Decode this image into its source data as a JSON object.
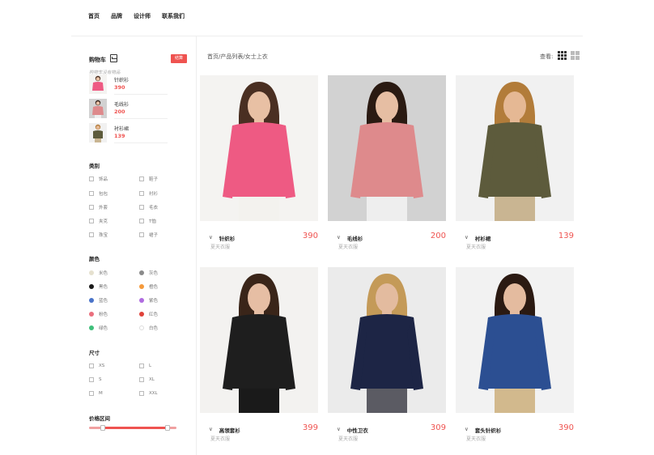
{
  "nav": [
    "首页",
    "品牌",
    "设计师",
    "联系我们"
  ],
  "cart": {
    "title": "购物车",
    "checkout_label": "结算",
    "empty_text": "购物车没有物品",
    "items": [
      {
        "name": "针织衫",
        "price": "390"
      },
      {
        "name": "毛线衫",
        "price": "200"
      },
      {
        "name": "衬衫裙",
        "price": "139"
      }
    ]
  },
  "filters": {
    "category": {
      "title": "类别",
      "options": [
        "饰品",
        "鞋子",
        "包包",
        "衬衫",
        "外套",
        "毛衣",
        "夹克",
        "T恤",
        "珠宝",
        "裙子"
      ]
    },
    "color": {
      "title": "颜色",
      "options": [
        {
          "label": "米色",
          "color": "#e6e1cf"
        },
        {
          "label": "灰色",
          "color": "#8a8a8a"
        },
        {
          "label": "黑色",
          "color": "#1a1a1a"
        },
        {
          "label": "橙色",
          "color": "#f59a3c"
        },
        {
          "label": "蓝色",
          "color": "#4a74c9"
        },
        {
          "label": "紫色",
          "color": "#b06ce0"
        },
        {
          "label": "粉色",
          "color": "#ea6f7d"
        },
        {
          "label": "红色",
          "color": "#e0423a"
        },
        {
          "label": "绿色",
          "color": "#3fbf7a"
        },
        {
          "label": "白色",
          "color": "#ffffff"
        }
      ]
    },
    "size": {
      "title": "尺寸",
      "options": [
        "XS",
        "L",
        "S",
        "XL",
        "M",
        "XXL"
      ]
    },
    "price": {
      "title": "价格区间"
    }
  },
  "main": {
    "breadcrumb": "首页/产品列表/女士上衣",
    "view_label": "查看:",
    "products": [
      {
        "name": "针织衫",
        "price": "390",
        "sub": "夏天衣服",
        "bg": "#f4f3f1",
        "top": "#ee5a83",
        "skin": "#e8c0a4",
        "hair": "#4a2f22",
        "bottom": "#f3f2ee"
      },
      {
        "name": "毛线衫",
        "price": "200",
        "sub": "夏天衣服",
        "bg": "#d2d2d2",
        "top": "#de8a8c",
        "skin": "#e6bea3",
        "hair": "#2a1a12",
        "bottom": "#eeeeee"
      },
      {
        "name": "衬衫裙",
        "price": "139",
        "sub": "夏天衣服",
        "bg": "#f1f1f1",
        "top": "#5d5b3c",
        "skin": "#e5b894",
        "hair": "#b27c3a",
        "bottom": "#c9b592"
      },
      {
        "name": "高领套衫",
        "price": "399",
        "sub": "夏天衣服",
        "bg": "#f3f2f0",
        "top": "#1e1e1e",
        "skin": "#e6bea4",
        "hair": "#3a2519",
        "bottom": "#1a1a1a"
      },
      {
        "name": "中性卫衣",
        "price": "309",
        "sub": "夏天衣服",
        "bg": "#ebebeb",
        "top": "#1d2545",
        "skin": "#e3bb9f",
        "hair": "#c49a58",
        "bottom": "#5b5b63"
      },
      {
        "name": "套头针织衫",
        "price": "390",
        "sub": "夏天衣服",
        "bg": "#f2f2f2",
        "top": "#2c4f92",
        "skin": "#e4bb9f",
        "hair": "#2b1a12",
        "bottom": "#d2b98d"
      }
    ]
  }
}
